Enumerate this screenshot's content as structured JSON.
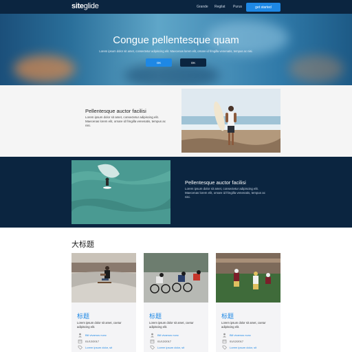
{
  "nav": {
    "logo_main": "site",
    "logo_accent": "glide",
    "links": [
      "Grande",
      "Regilat",
      "Purus"
    ],
    "cta_label": "get started"
  },
  "hero": {
    "title": "Congue pellentesque quam",
    "subtitle": "Lorem ipsum dolor sit amet, consectetur adipiscing elit. Maecenas lorem elit, ornare id fringilla venenatis, tempus ac nisi.",
    "primary_button": "OK",
    "secondary_button": "OK",
    "colors": {
      "primary": "#1e88e5",
      "secondary": "#0b2540"
    }
  },
  "features": [
    {
      "title": "Pellentesque auctor facilisi",
      "body": "Lorem ipsum dolor sit amet, consectetur adipiscing elit. Maecenas lorem elit, ornare id fringilla venenatis, tempus ac nisi."
    },
    {
      "title": "Pellentesque auctor facilisi",
      "body": "Lorem ipsum dolor sit amet, consectetur adipiscing elit. Maecenas lorem elit, ornare id fringilla venenatis, tempus ac nisi."
    }
  ],
  "cards_section": {
    "heading": "大标题",
    "cards": [
      {
        "image": "skateboarder-image",
        "title": "标题",
        "body": "Lorem ipsum dolor sit amet, coetur adipiscing elit.",
        "link": "Bill vivamus nunc",
        "date": "01/12/2017",
        "link2": "Lorem ipsum dolor, sit"
      },
      {
        "image": "cyclists-image",
        "title": "标题",
        "body": "Lorem ipsum dolor sit amet, coetur adipiscing elit.",
        "link": "Bill vivamus nunc",
        "date": "01/12/2017",
        "link2": "Lorem ipsum dolor, sit"
      },
      {
        "image": "football-image",
        "title": "标题",
        "body": "Lorem ipsum dolor sit amet, coetur adipiscing elit.",
        "link": "Bill vivamus nunc",
        "date": "01/12/2017",
        "link2": "Lorem ipsum dolor, sit"
      }
    ]
  }
}
